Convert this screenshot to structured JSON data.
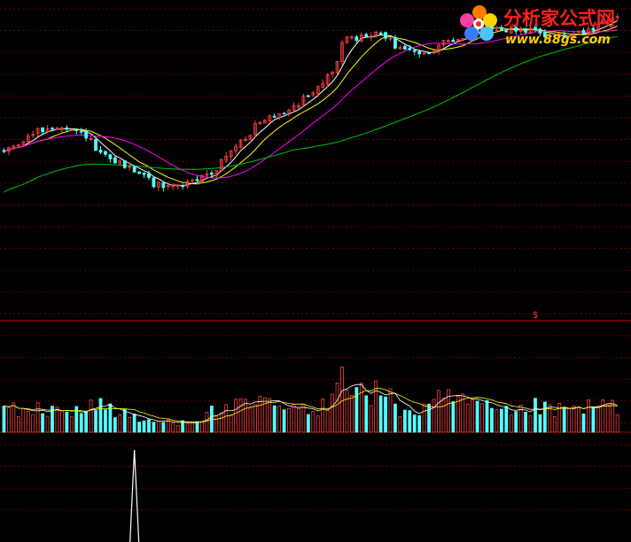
{
  "watermark": {
    "brand_cn": "分析家公式网",
    "url": "www.88gs.com"
  },
  "signal": {
    "label": "$",
    "bar_index": 110
  },
  "colors": {
    "background": "#000000",
    "grid": "#8a0000",
    "divider": "#d00000",
    "up": "#ff4040",
    "down": "#54ffff",
    "ma_short": "#ffffff",
    "ma_mid": "#ffff00",
    "ma_long": "#ff00ff",
    "ma_longest": "#00c000",
    "vol_ma_short": "#ffffff",
    "vol_ma_long": "#ffff00",
    "spike": "#ffffff"
  },
  "chart_data": [
    {
      "type": "candlestick",
      "panel": "price",
      "bars": 128,
      "price_path": [
        [
          0,
          100
        ],
        [
          4,
          103
        ],
        [
          9,
          106
        ],
        [
          13,
          105
        ],
        [
          17,
          104
        ],
        [
          20,
          99
        ],
        [
          24,
          97
        ],
        [
          28,
          95
        ],
        [
          31,
          92
        ],
        [
          35,
          91.5
        ],
        [
          39,
          92.5
        ],
        [
          43,
          95
        ],
        [
          47,
          100
        ],
        [
          52,
          106
        ],
        [
          56,
          109
        ],
        [
          60,
          111
        ],
        [
          64,
          115
        ],
        [
          68,
          119
        ],
        [
          70,
          127
        ],
        [
          74,
          128
        ],
        [
          78,
          129
        ],
        [
          81,
          126
        ],
        [
          85,
          124
        ],
        [
          88,
          125
        ],
        [
          92,
          127
        ],
        [
          96,
          129
        ],
        [
          100,
          131
        ],
        [
          104,
          130
        ],
        [
          108,
          130
        ],
        [
          112,
          129
        ],
        [
          116,
          128
        ],
        [
          120,
          129
        ],
        [
          124,
          131
        ],
        [
          127,
          133
        ]
      ],
      "series": [
        {
          "name": "MA5",
          "window": 5
        },
        {
          "name": "MA10",
          "window": 10
        },
        {
          "name": "MA20",
          "window": 20
        },
        {
          "name": "MA60",
          "window": 60
        }
      ],
      "ylim": [
        72,
        135
      ],
      "grid": true
    },
    {
      "type": "bar",
      "panel": "volume",
      "bars": 128,
      "volume_path": [
        [
          0,
          20
        ],
        [
          10,
          16
        ],
        [
          20,
          22
        ],
        [
          28,
          9
        ],
        [
          35,
          8
        ],
        [
          40,
          11
        ],
        [
          44,
          17
        ],
        [
          50,
          20
        ],
        [
          55,
          22
        ],
        [
          60,
          18
        ],
        [
          65,
          14
        ],
        [
          70,
          48
        ],
        [
          74,
          30
        ],
        [
          78,
          32
        ],
        [
          82,
          18
        ],
        [
          86,
          16
        ],
        [
          90,
          24
        ],
        [
          94,
          26
        ],
        [
          98,
          20
        ],
        [
          102,
          16
        ],
        [
          106,
          14
        ],
        [
          110,
          20
        ],
        [
          114,
          16
        ],
        [
          118,
          18
        ],
        [
          122,
          20
        ],
        [
          127,
          22
        ]
      ],
      "series": [
        {
          "name": "VOL-MA5",
          "window": 5
        },
        {
          "name": "VOL-MA10",
          "window": 10
        }
      ],
      "ylim": [
        0,
        55
      ]
    },
    {
      "type": "line",
      "panel": "indicator",
      "spike_index": 27,
      "values": "zero everywhere except a single sharp spike at spike_index"
    }
  ]
}
